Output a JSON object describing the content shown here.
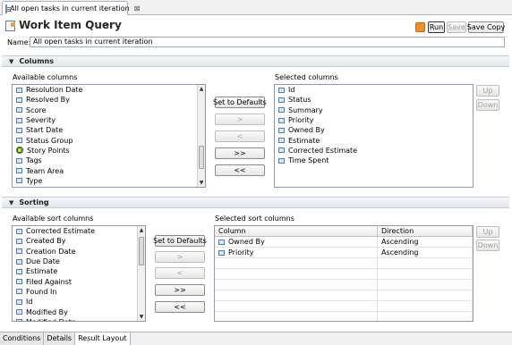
{
  "tab": {
    "title": "All open tasks in current iteration",
    "close_symbol": "⊠"
  },
  "header": {
    "title": "Work Item Query",
    "caret": "▾",
    "run_label": "Run",
    "save_label": "Save",
    "save_copy_label": "Save Copy"
  },
  "name_field": {
    "label": "Name:",
    "value": "All open tasks in current iteration"
  },
  "columns": {
    "title": "Columns",
    "available_label": "Available columns",
    "available": [
      {
        "label": "Resolution Date",
        "icon": "attribute-icon"
      },
      {
        "label": "Resolved By",
        "icon": "attribute-icon"
      },
      {
        "label": "Score",
        "icon": "attribute-icon"
      },
      {
        "label": "Severity",
        "icon": "attribute-icon"
      },
      {
        "label": "Start Date",
        "icon": "attribute-icon"
      },
      {
        "label": "Status Group",
        "icon": "attribute-icon"
      },
      {
        "label": "Story Points",
        "icon": "story-points-icon"
      },
      {
        "label": "Tags",
        "icon": "attribute-icon"
      },
      {
        "label": "Team Area",
        "icon": "attribute-icon"
      },
      {
        "label": "Type",
        "icon": "attribute-icon"
      }
    ],
    "set_defaults_label": "Set to Defaults",
    "add_label": ">",
    "remove_label": "<",
    "add_all_label": ">>",
    "remove_all_label": "<<",
    "selected_label": "Selected columns",
    "selected": [
      "Id",
      "Status",
      "Summary",
      "Priority",
      "Owned By",
      "Estimate",
      "Corrected Estimate",
      "Time Spent"
    ],
    "up_label": "Up",
    "down_label": "Down"
  },
  "sorting": {
    "title": "Sorting",
    "available_label": "Available sort columns",
    "available": [
      "Corrected Estimate",
      "Created By",
      "Creation Date",
      "Due Date",
      "Estimate",
      "Filed Against",
      "Found In",
      "Id",
      "Modified By",
      "Modified Date"
    ],
    "set_defaults_label": "Set to Defaults",
    "add_label": ">",
    "remove_label": "<",
    "add_all_label": ">>",
    "remove_all_label": "<<",
    "selected_label": "Selected sort columns",
    "table_headers": {
      "column": "Column",
      "direction": "Direction"
    },
    "rows": [
      {
        "column": "Owned By",
        "direction": "Ascending"
      },
      {
        "column": "Priority",
        "direction": "Ascending"
      }
    ],
    "up_label": "Up",
    "down_label": "Down"
  },
  "bottom_tabs": [
    "Conditions",
    "Details",
    "Result Layout"
  ],
  "colors": {
    "accent": "#4a7fb0",
    "rss": "#f0902a"
  }
}
